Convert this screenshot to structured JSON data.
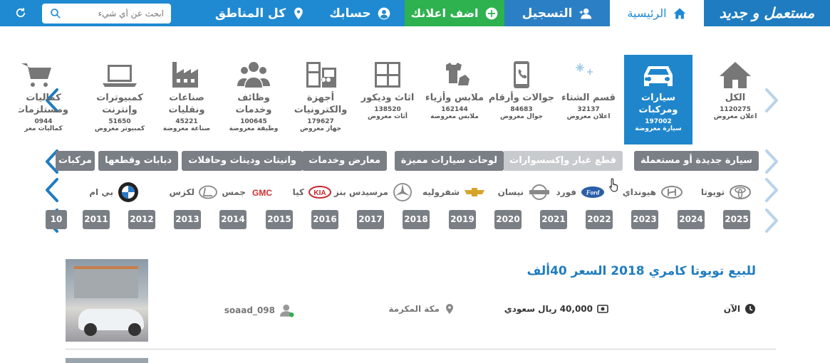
{
  "header": {
    "logo": "مستعمل و جديد",
    "home": "الرئيسية",
    "register": "التسجيل",
    "add_ad": "اضف اعلانك",
    "account": "حسابك",
    "regions": "كل المناطق",
    "search_placeholder": "ابحث عن أي شيء",
    "colors": {
      "bar": "#1f8ad1",
      "add": "#2eb14f"
    }
  },
  "categories": [
    {
      "name": "الكل",
      "count": "1120275",
      "sub": "اعلان معروض",
      "icon": "home-icon"
    },
    {
      "name": "سيارات ومركبات",
      "count": "197002",
      "sub": "سيارة معروضة",
      "icon": "car-icon",
      "active": true
    },
    {
      "name": "قسم الشتاء",
      "count": "32137",
      "sub": "اعلان معروض",
      "icon": "snowflake-icon"
    },
    {
      "name": "جوالات وأرقام",
      "count": "84683",
      "sub": "جوال معروض",
      "icon": "phone-icon"
    },
    {
      "name": "ملابس وأزياء",
      "count": "162144",
      "sub": "ملابس معروضة",
      "icon": "clothes-icon"
    },
    {
      "name": "اثاث وديكور",
      "count": "138520",
      "sub": "أثاث معروض",
      "icon": "furniture-icon"
    },
    {
      "name": "أجهزة والكترونيات",
      "count": "179627",
      "sub": "جهاز معروض",
      "icon": "appliance-icon"
    },
    {
      "name": "وظائف وخدمات",
      "count": "100645",
      "sub": "وظيفة معروضة",
      "icon": "people-icon"
    },
    {
      "name": "صناعات ونقليات",
      "count": "45221",
      "sub": "صناعة معروضة",
      "icon": "factory-icon"
    },
    {
      "name": "كمبيوترات وإنترنت",
      "count": "51650",
      "sub": "كمبيوتر معروض",
      "icon": "laptop-icon"
    },
    {
      "name": "كماليات ومستلزمات",
      "count": "0944",
      "sub": "كماليات معر",
      "icon": "cart-icon"
    }
  ],
  "subcategories": [
    "سيارة جديدة أو مستعملة",
    "قطع غيار وإكسسوارات",
    "لوحات سيارات مميزة",
    "معارض وخدمات",
    "وانيتات ودينات وحافلات",
    "دبابات وقطعها",
    "مركبات"
  ],
  "brands": [
    "تويوتا",
    "هيونداي",
    "فورد",
    "نيسان",
    "شفروليه",
    "مرسيدس بنز",
    "كيا",
    "جمس",
    "لكزس",
    "بي ام"
  ],
  "brand_logos": {
    "gmc": "GMC",
    "kia": "KIA"
  },
  "years": [
    "2025",
    "2024",
    "2023",
    "2022",
    "2021",
    "2020",
    "2019",
    "2018",
    "2017",
    "2016",
    "2015",
    "2014",
    "2013",
    "2012",
    "2011",
    "10"
  ],
  "listing": {
    "title": "للبيع تويوتا كامري 2018 السعر 40ألف",
    "time": "الآن",
    "price": "40,000 ريال سعودي",
    "location": "مكة المكرمة",
    "user": "soaad_098"
  }
}
